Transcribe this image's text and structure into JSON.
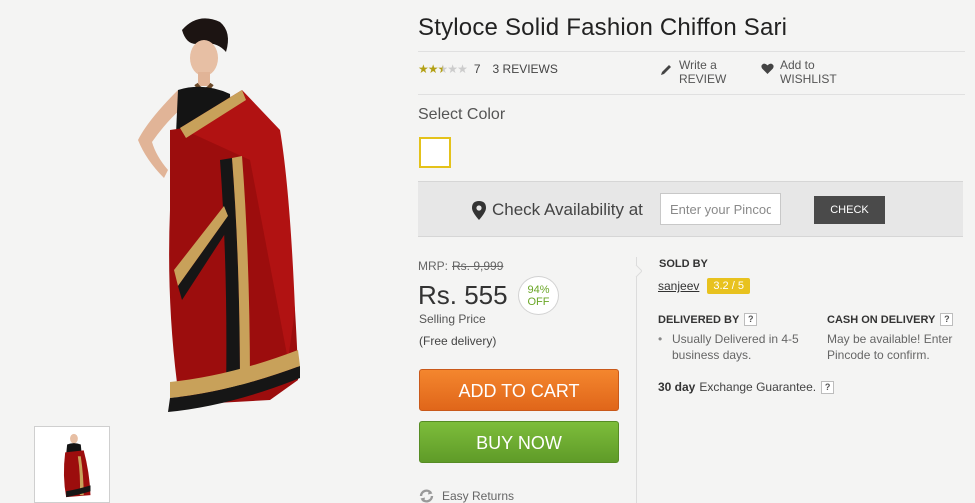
{
  "product": {
    "title": "Styloce Solid Fashion Chiffon Sari",
    "rating_value": "7",
    "rating_stars_filled": 2.5,
    "rating_stars_total": 5,
    "reviews_link": "3 REVIEWS"
  },
  "actions": {
    "write_review_line1": "Write a",
    "write_review_line2": "REVIEW",
    "wishlist_line1": "Add to",
    "wishlist_line2": "WISHLIST",
    "write_icon": "pencil-icon",
    "wishlist_icon": "heart-icon"
  },
  "color_select": {
    "label": "Select Color",
    "swatch_border_color": "#e4c21a"
  },
  "availability": {
    "label": "Check Availability at",
    "pin_placeholder": "Enter your Pincode",
    "check_label": "CHECK",
    "icon": "map-pin-icon"
  },
  "pricing": {
    "mrp_label": "MRP:",
    "mrp_value": "Rs. 9,999",
    "price": "Rs. 555",
    "discount_line1": "94%",
    "discount_line2": "OFF",
    "selling_price_label": "Selling Price",
    "free_delivery": "(Free delivery)"
  },
  "buttons": {
    "add_to_cart": "ADD TO CART",
    "buy_now": "BUY NOW",
    "add_to_cart_color": "#e8701f",
    "buy_now_color": "#6ca831"
  },
  "easy_returns": {
    "label": "Easy Returns",
    "icon": "refresh-icon"
  },
  "seller": {
    "sold_by_label": "SOLD BY",
    "name": "sanjeev",
    "rating": "3.2 / 5",
    "rating_color": "#e8c21e"
  },
  "delivery": {
    "delivered_by_label": "DELIVERED BY",
    "delivered_text_line1": "Usually Delivered in 4-5",
    "delivered_text_line2": "business days.",
    "cod_label": "CASH ON DELIVERY",
    "cod_text": "May be available! Enter Pincode to confirm.",
    "help_mark": "?"
  },
  "exchange": {
    "bold": "30 day",
    "text": "Exchange Guarantee.",
    "help_mark": "?"
  }
}
